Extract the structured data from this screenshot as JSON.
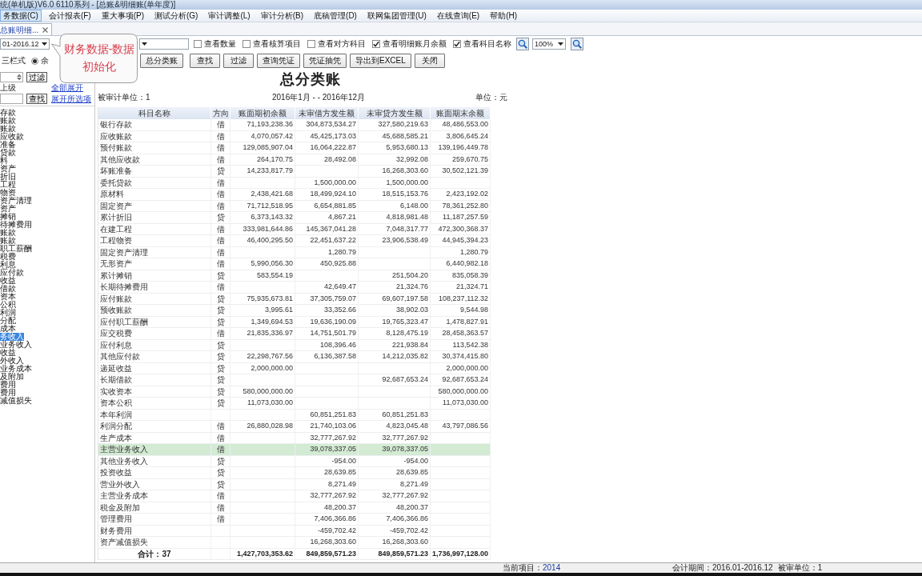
{
  "window": {
    "title": "统(单机版)V6.0 6110系列 - [总账&明细账(单年度)]"
  },
  "menu": [
    {
      "label": "务数据(C)",
      "selected": true
    },
    {
      "label": "会计报表(F)",
      "selected": false
    },
    {
      "label": "重大事项(P)",
      "selected": false
    },
    {
      "label": "测试分析(G)",
      "selected": false
    },
    {
      "label": "审计调整(L)",
      "selected": false
    },
    {
      "label": "审计分析(B)",
      "selected": false
    },
    {
      "label": "底稿管理(D)",
      "selected": false
    },
    {
      "label": "联网集团管理(U)",
      "selected": false
    },
    {
      "label": "在线查询(E)",
      "selected": false
    },
    {
      "label": "帮助(H)",
      "selected": false
    }
  ],
  "tabs": [
    {
      "label": "总账明细...",
      "selected": true
    }
  ],
  "toolbar": {
    "period_select": {
      "value": "01-2016.12"
    },
    "checkboxes": [
      {
        "label": "查看数量",
        "checked": false
      },
      {
        "label": "查看核算项目",
        "checked": false
      },
      {
        "label": "查看对方科目",
        "checked": false
      },
      {
        "label": "查看明细账月余额",
        "checked": true
      },
      {
        "label": "查看科目名称",
        "checked": true
      }
    ],
    "zoom_select": {
      "value": "100%"
    }
  },
  "view_bar": {
    "mode_label": "三栏式",
    "radio": {
      "label": "余",
      "selected": true
    },
    "ledger_button": "总分类账",
    "buttons": [
      "查找",
      "过滤",
      "查询凭证",
      "凭证抽凭",
      "导出到EXCEL",
      "关闭"
    ]
  },
  "sidebar": {
    "filter_button": "过滤",
    "parent_label": "上级",
    "search_button": "查找",
    "links": [
      "全部展开",
      "展开所选项"
    ],
    "items": [
      {
        "label": "存款",
        "selected": false
      },
      {
        "label": "账款",
        "selected": false
      },
      {
        "label": "账款",
        "selected": false
      },
      {
        "label": "应收款",
        "selected": false
      },
      {
        "label": "准备",
        "selected": false
      },
      {
        "label": "贷款",
        "selected": false
      },
      {
        "label": "料",
        "selected": false
      },
      {
        "label": "资产",
        "selected": false
      },
      {
        "label": "折旧",
        "selected": false
      },
      {
        "label": "工程",
        "selected": false
      },
      {
        "label": "物资",
        "selected": false
      },
      {
        "label": "资产清理",
        "selected": false
      },
      {
        "label": "资产",
        "selected": false
      },
      {
        "label": "摊销",
        "selected": false
      },
      {
        "label": "待摊费用",
        "selected": false
      },
      {
        "label": "账款",
        "selected": false
      },
      {
        "label": "账款",
        "selected": false
      },
      {
        "label": "职工薪酬",
        "selected": false
      },
      {
        "label": "税费",
        "selected": false
      },
      {
        "label": "利息",
        "selected": false
      },
      {
        "label": "应付款",
        "selected": false
      },
      {
        "label": "收益",
        "selected": false
      },
      {
        "label": "借款",
        "selected": false
      },
      {
        "label": "资本",
        "selected": false
      },
      {
        "label": "公积",
        "selected": false
      },
      {
        "label": "利润",
        "selected": false
      },
      {
        "label": "分配",
        "selected": false
      },
      {
        "label": "成本",
        "selected": false
      },
      {
        "label": "务收入",
        "selected": true
      },
      {
        "label": "业务收入",
        "selected": false
      },
      {
        "label": "收益",
        "selected": false
      },
      {
        "label": "外收入",
        "selected": false
      },
      {
        "label": "业务成本",
        "selected": false
      },
      {
        "label": "及附加",
        "selected": false
      },
      {
        "label": "费用",
        "selected": false
      },
      {
        "label": "费用",
        "selected": false
      },
      {
        "label": "减值损失",
        "selected": false
      }
    ]
  },
  "report": {
    "title": "总分类账",
    "audited_unit": "被审计单位：1",
    "period": "2016年1月 - - 2016年12月",
    "unit": "单位：元",
    "columns": [
      "科目名称",
      "方向",
      "账面期初余额",
      "未审借方发生额",
      "未审贷方发生额",
      "账面期末余额"
    ],
    "rows": [
      {
        "name": "银行存款",
        "direction": "借",
        "opening": "71,193,238.36",
        "debit": "304,873,534.27",
        "credit": "327,580,219.63",
        "closing": "48,486,553.00",
        "selected": false
      },
      {
        "name": "应收账款",
        "direction": "借",
        "opening": "4,070,057.42",
        "debit": "45,425,173.03",
        "credit": "45,688,585.21",
        "closing": "3,806,645.24",
        "selected": false
      },
      {
        "name": "预付账款",
        "direction": "借",
        "opening": "129,085,907.04",
        "debit": "16,064,222.87",
        "credit": "5,953,680.13",
        "closing": "139,196,449.78",
        "selected": false
      },
      {
        "name": "其他应收款",
        "direction": "借",
        "opening": "264,170.75",
        "debit": "28,492.08",
        "credit": "32,992.08",
        "closing": "259,670.75",
        "selected": false
      },
      {
        "name": "坏账准备",
        "direction": "贷",
        "opening": "14,233,817.79",
        "credit": "16,268,303.60",
        "closing": "30,502,121.39",
        "selected": false
      },
      {
        "name": "委托贷款",
        "direction": "借",
        "debit": "1,500,000.00",
        "credit": "1,500,000.00",
        "selected": false
      },
      {
        "name": "原材料",
        "direction": "借",
        "opening": "2,438,421.68",
        "debit": "18,499,924.10",
        "credit": "18,515,153.76",
        "closing": "2,423,192.02",
        "selected": false
      },
      {
        "name": "固定资产",
        "direction": "借",
        "opening": "71,712,518.95",
        "debit": "6,654,881.85",
        "credit": "6,148.00",
        "closing": "78,361,252.80",
        "selected": false
      },
      {
        "name": "累计折旧",
        "direction": "贷",
        "opening": "6,373,143.32",
        "debit": "4,867.21",
        "credit": "4,818,981.48",
        "closing": "11,187,257.59",
        "selected": false
      },
      {
        "name": "在建工程",
        "direction": "借",
        "opening": "333,981,644.86",
        "debit": "145,367,041.28",
        "credit": "7,048,317.77",
        "closing": "472,300,368.37",
        "selected": false
      },
      {
        "name": "工程物资",
        "direction": "借",
        "opening": "46,400,295.50",
        "debit": "22,451,637.22",
        "credit": "23,906,538.49",
        "closing": "44,945,394.23",
        "selected": false
      },
      {
        "name": "固定资产清理",
        "direction": "借",
        "debit": "1,280.79",
        "closing": "1,280.79",
        "selected": false
      },
      {
        "name": "无形资产",
        "direction": "借",
        "opening": "5,990,056.30",
        "debit": "450,925.88",
        "closing": "6,440,982.18",
        "selected": false
      },
      {
        "name": "累计摊销",
        "direction": "贷",
        "opening": "583,554.19",
        "credit": "251,504.20",
        "closing": "835,058.39",
        "selected": false
      },
      {
        "name": "长期待摊费用",
        "direction": "借",
        "debit": "42,649.47",
        "credit": "21,324.76",
        "closing": "21,324.71",
        "selected": false
      },
      {
        "name": "应付账款",
        "direction": "贷",
        "opening": "75,935,673.81",
        "debit": "37,305,759.07",
        "credit": "69,607,197.58",
        "closing": "108,237,112.32",
        "selected": false
      },
      {
        "name": "预收账款",
        "direction": "贷",
        "opening": "3,995.61",
        "debit": "33,352.66",
        "credit": "38,902.03",
        "closing": "9,544.98",
        "selected": false
      },
      {
        "name": "应付职工薪酬",
        "direction": "贷",
        "opening": "1,349,694.53",
        "debit": "19,636,190.09",
        "credit": "19,765,323.47",
        "closing": "1,478,827.91",
        "selected": false
      },
      {
        "name": "应交税费",
        "direction": "借",
        "opening": "21,835,336.97",
        "debit": "14,751,501.79",
        "credit": "8,128,475.19",
        "closing": "28,458,363.57",
        "selected": false
      },
      {
        "name": "应付利息",
        "direction": "贷",
        "debit": "108,396.46",
        "credit": "221,938.84",
        "closing": "113,542.38",
        "selected": false
      },
      {
        "name": "其他应付款",
        "direction": "贷",
        "opening": "22,298,767.56",
        "debit": "6,136,387.58",
        "credit": "14,212,035.82",
        "closing": "30,374,415.80",
        "selected": false
      },
      {
        "name": "递延收益",
        "direction": "贷",
        "opening": "2,000,000.00",
        "closing": "2,000,000.00",
        "selected": false
      },
      {
        "name": "长期借款",
        "direction": "贷",
        "credit": "92,687,653.24",
        "closing": "92,687,653.24",
        "selected": false
      },
      {
        "name": "实收资本",
        "direction": "贷",
        "opening": "580,000,000.00",
        "closing": "580,000,000.00",
        "selected": false
      },
      {
        "name": "资本公积",
        "direction": "贷",
        "opening": "11,073,030.00",
        "closing": "11,073,030.00",
        "selected": false
      },
      {
        "name": "本年利润",
        "debit": "60,851,251.83",
        "credit": "60,851,251.83",
        "selected": false
      },
      {
        "name": "利润分配",
        "direction": "借",
        "opening": "26,880,028.98",
        "debit": "21,740,103.06",
        "credit": "4,823,045.48",
        "closing": "43,797,086.56",
        "selected": false
      },
      {
        "name": "生产成本",
        "direction": "借",
        "debit": "32,777,267.92",
        "credit": "32,777,267.92",
        "selected": false
      },
      {
        "name": "主营业务收入",
        "direction": "借",
        "debit": "39,078,337.05",
        "credit": "39,078,337.05",
        "selected": true
      },
      {
        "name": "其他业务收入",
        "direction": "贷",
        "debit": "-954.00",
        "credit": "-954.00",
        "selected": false
      },
      {
        "name": "投资收益",
        "direction": "贷",
        "debit": "28,639.85",
        "credit": "28,639.85",
        "selected": false
      },
      {
        "name": "营业外收入",
        "direction": "贷",
        "debit": "8,271.49",
        "credit": "8,271.49",
        "selected": false
      },
      {
        "name": "主营业务成本",
        "direction": "借",
        "debit": "32,777,267.92",
        "credit": "32,777,267.92",
        "selected": false
      },
      {
        "name": "税金及附加",
        "direction": "借",
        "debit": "48,200.37",
        "credit": "48,200.37",
        "selected": false
      },
      {
        "name": "管理费用",
        "direction": "借",
        "debit": "7,406,366.86",
        "credit": "7,406,366.86",
        "selected": false
      },
      {
        "name": "财务费用",
        "debit": "-459,702.42",
        "credit": "-459,702.42",
        "selected": false
      },
      {
        "name": "资产减值损失",
        "debit": "16,268,303.60",
        "credit": "16,268,303.60",
        "selected": false
      }
    ],
    "total": {
      "name": "合计：37",
      "opening": "1,427,703,353.62",
      "debit": "849,859,571.23",
      "credit": "849,859,571.23",
      "closing": "1,736,997,128.00"
    }
  },
  "status_bar": {
    "project_label": "当前项目：",
    "project": "2014",
    "period": "会计期间：2016.01-2016.12",
    "unit": "被审单位：1"
  },
  "tooltip": {
    "text": "财务数据-数据初始化"
  }
}
